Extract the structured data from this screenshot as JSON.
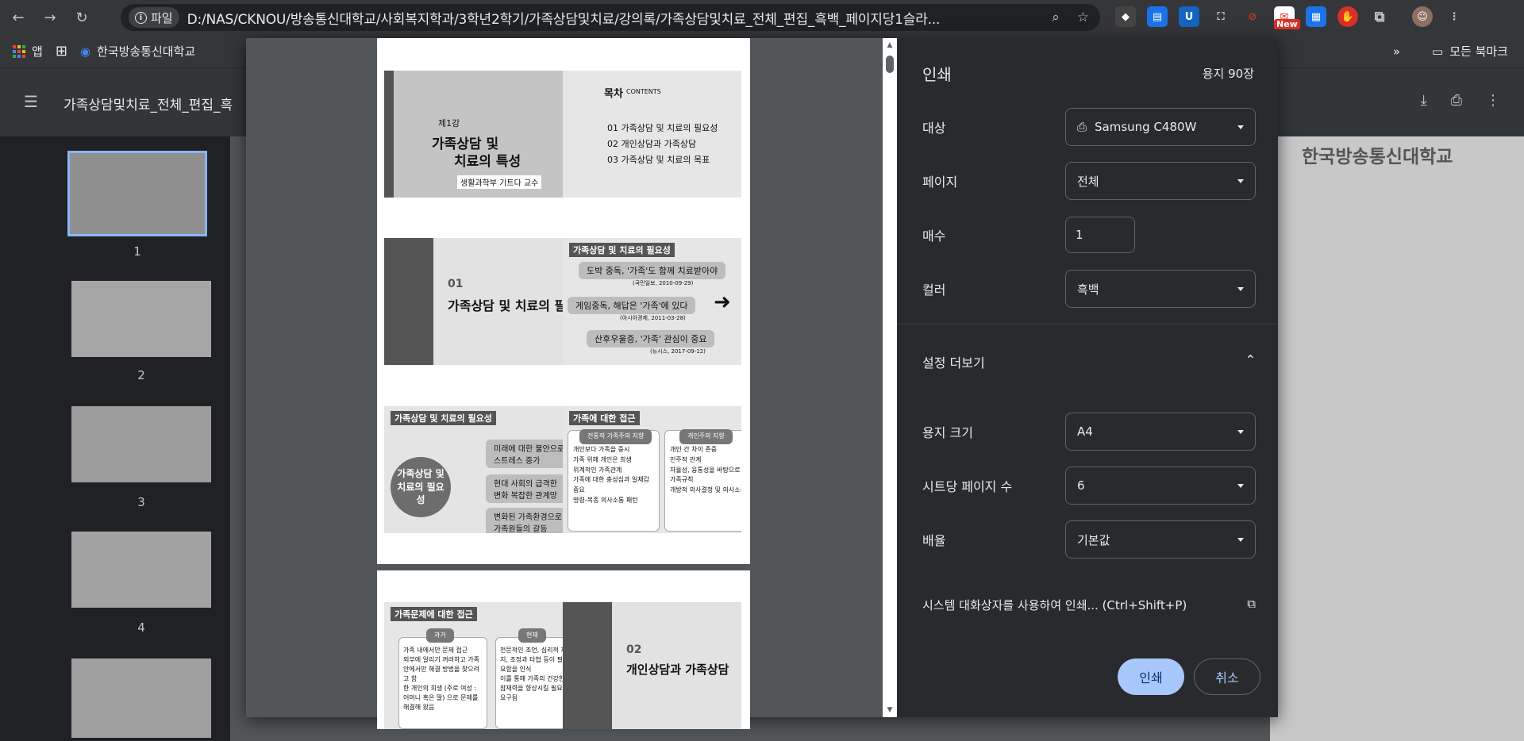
{
  "browser": {
    "file_chip": "파일",
    "url": "D:/NAS/CKNOU/방송통신대학교/사회복지학과/3학년2학기/가족상담및치료/강의록/가족상담및치료_전체_편집_흑백_페이지당1슬라...",
    "new_badge": "New"
  },
  "bookmarks": {
    "apps_label": "앱",
    "items": [
      "한국방송통신대학교"
    ],
    "more": "»",
    "all_bookmarks": "모든 북마크"
  },
  "pdf": {
    "title": "가족상담및치료_전체_편집_흑",
    "background_logo": "한국방송통신대학교",
    "thumbnails": [
      "1",
      "2",
      "3",
      "4"
    ]
  },
  "preview": {
    "slide1_left": {
      "chapter": "제1강",
      "title1": "가족상담 및",
      "title2": "치료의 특성",
      "author": "생활과학부 기트다 교수"
    },
    "slide1_right": {
      "contents": "목차",
      "contents_en": "CONTENTS",
      "items": [
        "01 가족상담 및 치료의 필요성",
        "02 개인상담과 가족상담",
        "03 가족상담 및 치료의 목표"
      ]
    },
    "slide2_left": {
      "chapter": "01",
      "title": "가족상담 및 치료의 필"
    },
    "slide2_right": {
      "head": "가족상담 및 치료의 필요성",
      "news": [
        "도박 중독, '가족'도 함께 치료받아야",
        "게임중독, 해답은 '가족'에 있다",
        "산후우울증, '가족' 관심이 중요"
      ],
      "sources": [
        "(국민일보, 2010-09-29)",
        "(아시아경제, 2011-03-28)",
        "(뉴시스, 2017-09-12)"
      ]
    },
    "slide3_left": {
      "head": "가족상담 및 치료의 필요성",
      "circle": "가족상담 및 치료의 필요성",
      "items": [
        "미래에 대한 불안으로 스트레스 증가",
        "현대 사회의 급격한 변화 복잡한 관계망",
        "변화된 가족환경으로 가족원들의 갈등"
      ]
    },
    "slide3_right": {
      "head": "가족에 대한 접근",
      "col1_head": "전통적 가족주의 지향",
      "col1": [
        "개인보다 가족을 중시",
        "가족 위해 개인은 희생",
        "위계적인 가족관계",
        "가족에 대한 충성심과 일체감 중요",
        "명령-복종 의사소통 패턴"
      ],
      "col2_head": "개인주의 지향",
      "col2": [
        "개인 간 차이 존중",
        "민주적 관계",
        "자율성, 융통성을 바탕으로 가족규칙",
        "개방적 의사결정 및 의사소통"
      ]
    },
    "slide4_left": {
      "head": "가족문제에 대한 접근",
      "col1_head": "과거",
      "col1": [
        "가족 내에서만 문제 접근",
        "외부에 알리기 꺼려하고 가족 안에서만 해결 방법을 찾으려고 함",
        "한 개인의 희생 (주로 여성 : 어머니 혹은 딸) 으로 문제를 해결해 왔음"
      ],
      "col2_head": "현재",
      "col2": [
        "전문적인 조언, 심리적 지지, 조정과 타협 등이 필요함을 인식",
        "이를 통해 가족의 건강한 잠재력을 향상시킬 필요 요구됨"
      ]
    },
    "slide4_right": {
      "chapter": "02",
      "title": "개인상담과 가족상담"
    }
  },
  "print": {
    "title": "인쇄",
    "sheet_count": "용지 90장",
    "destination_label": "대상",
    "destination_value": "Samsung C480W",
    "pages_label": "페이지",
    "pages_value": "전체",
    "copies_label": "매수",
    "copies_value": "1",
    "color_label": "컬러",
    "color_value": "흑백",
    "more_settings": "설정 더보기",
    "paper_size_label": "용지 크기",
    "paper_size_value": "A4",
    "pages_per_sheet_label": "시트당 페이지 수",
    "pages_per_sheet_value": "6",
    "scale_label": "배율",
    "scale_value": "기본값",
    "system_dialog": "시스템 대화상자를 사용하여 인쇄... (Ctrl+Shift+P)",
    "print_button": "인쇄",
    "cancel_button": "취소"
  }
}
